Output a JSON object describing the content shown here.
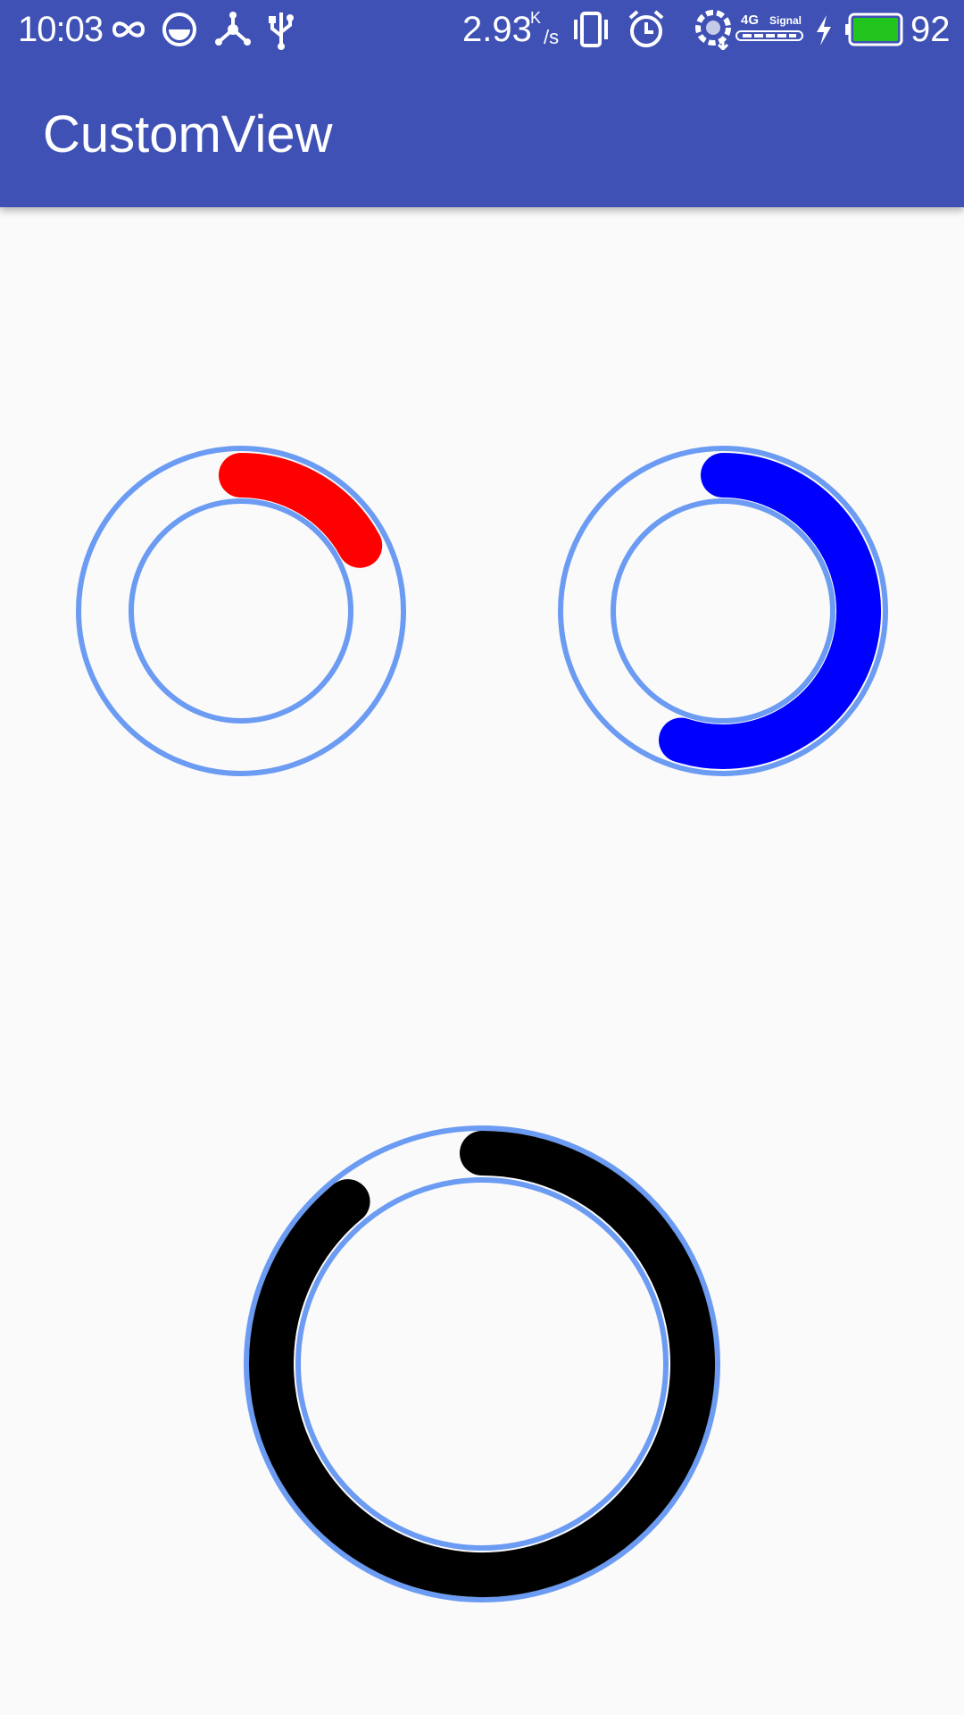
{
  "status_bar": {
    "time": "10:03",
    "net_speed": "2.93",
    "net_speed_unit_top": "K",
    "net_speed_unit_bottom": "/s",
    "network_type": "4G",
    "signal_label": "Signal",
    "battery_percent": "92",
    "icons": [
      "infinity-icon",
      "data-saver-icon",
      "hotspot-icon",
      "usb-icon",
      "vibrate-icon",
      "alarm-icon",
      "wifi-icon",
      "signal-icon",
      "charging-icon",
      "battery-icon"
    ],
    "battery_color": "#22C51E"
  },
  "app_bar": {
    "title": "CustomView",
    "color": "#3F51B5"
  },
  "rings": [
    {
      "name": "ring-red",
      "progress_color": "#FF0000",
      "progress_fraction": 0.17
    },
    {
      "name": "ring-blue",
      "progress_color": "#0000FF",
      "progress_fraction": 0.55
    },
    {
      "name": "ring-black",
      "progress_color": "#000000",
      "progress_fraction": 0.89
    }
  ],
  "ring_outline_color": "#6B9BF2"
}
